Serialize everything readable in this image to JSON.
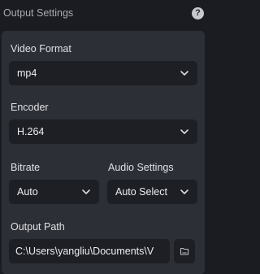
{
  "header": {
    "title": "Output Settings",
    "help_icon": "?"
  },
  "video_format": {
    "label": "Video Format",
    "value": "mp4"
  },
  "encoder": {
    "label": "Encoder",
    "value": "H.264"
  },
  "bitrate": {
    "label": "Bitrate",
    "value": "Auto"
  },
  "audio_settings": {
    "label": "Audio Settings",
    "value": "Auto Select"
  },
  "output_path": {
    "label": "Output Path",
    "value": "C:\\Users\\yangliu\\Documents\\V"
  },
  "icons": {
    "help": "help-icon",
    "chevron": "chevron-down-icon",
    "folder": "folder-icon"
  }
}
